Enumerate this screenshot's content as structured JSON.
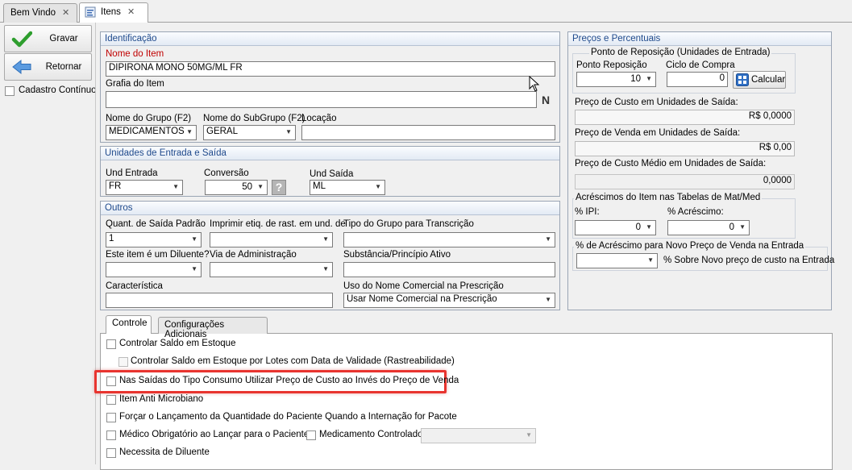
{
  "doc_tabs": [
    {
      "label": "Bem Vindo",
      "close": "✕"
    },
    {
      "label": "Itens",
      "close": "✕"
    }
  ],
  "toolbar": {
    "gravar": "Gravar",
    "retornar": "Retornar",
    "cadastro_continuo": "Cadastro Contínuo"
  },
  "identificacao": {
    "title": "Identificação",
    "nome_label": "Nome do Item",
    "nome_value": "DIPIRONA MONO 50MG/ML FR",
    "grafia_label": "Grafia do Item",
    "grafia_value": "",
    "n_glyph": "N",
    "grupo_label": "Nome do Grupo (F2)",
    "grupo_value": "MEDICAMENTOS",
    "subgrupo_label": "Nome do SubGrupo (F2)",
    "subgrupo_value": "GERAL",
    "locacao_label": "Locação",
    "locacao_value": ""
  },
  "unidades": {
    "title": "Unidades de Entrada e Saída",
    "und_entrada_label": "Und Entrada",
    "und_entrada_value": "FR",
    "conversao_label": "Conversão",
    "conversao_value": "50",
    "help_glyph": "?",
    "und_saida_label": "Und Saída",
    "und_saida_value": "ML"
  },
  "outros": {
    "title": "Outros",
    "quant_saida_label": "Quant. de Saída Padrão",
    "quant_saida_value": "1",
    "imprimir_label": "Imprimir etiq. de rast. em und. de",
    "imprimir_value": "",
    "tipo_grupo_label": "Tipo do Grupo para Transcrição",
    "tipo_grupo_value": "",
    "diluente_label": "Este item é um Diluente?",
    "diluente_value": "",
    "via_label": "Via de Administração",
    "via_value": "",
    "substancia_label": "Substância/Princípio Ativo",
    "substancia_value": "",
    "caracteristica_label": "Característica",
    "caracteristica_value": "",
    "uso_nome_label": "Uso do Nome Comercial na Prescrição",
    "uso_nome_value": "Usar Nome Comercial na Prescrição"
  },
  "precos": {
    "title": "Preços e Percentuais",
    "reposicao_legend": "Ponto de Reposição (Unidades de Entrada)",
    "ponto_label": "Ponto Reposição",
    "ponto_value": "10",
    "ciclo_label": "Ciclo de Compra",
    "ciclo_value": "0",
    "calcular": "Calcular",
    "custo_label": "Preço de Custo em Unidades de Saída:",
    "custo_value": "R$ 0,0000",
    "venda_label": "Preço de Venda em Unidades de Saída:",
    "venda_value": "R$ 0,00",
    "medio_label": "Preço de Custo Médio em Unidades de Saída:",
    "medio_value": "0,0000",
    "acrescimos_legend": "Acréscimos do Item nas Tabelas de Mat/Med",
    "ipi_label": "% IPI:",
    "ipi_value": "0",
    "acrescimo_label": "% Acréscimo:",
    "acrescimo_value": "0",
    "novo_legend": "% de Acréscimo para Novo Preço de Venda na Entrada",
    "novo_value": "",
    "novo_desc": "% Sobre Novo preço de custo na Entrada"
  },
  "bottom_tabs": [
    {
      "label": "Controle"
    },
    {
      "label": "Configurações Adicionais"
    }
  ],
  "controle": {
    "saldo_estoque": "Controlar Saldo em Estoque",
    "saldo_lotes": "Controlar Saldo em Estoque por Lotes com Data de Validade (Rastreabilidade)",
    "consumo_custo": "Nas Saídas do Tipo Consumo Utilizar Preço de Custo ao Invés do Preço de Venda",
    "anti_microbiano": "Item Anti Microbiano",
    "forcar_lancamento": "Forçar o Lançamento da Quantidade do Paciente Quando a Internação for Pacote",
    "medico_obrigatorio": "Médico Obrigatório ao Lançar para o Paciente",
    "medicamento_controlado": "Medicamento Controlado",
    "controlado_value": "",
    "necessita_diluente": "Necessita de Diluente"
  },
  "colors": {
    "group_title": "#1f4a8c",
    "required_label": "#c00000",
    "highlight": "#e8342f",
    "gravar_icon": "#2e9e2e",
    "retornar_icon": "#3a7fd0"
  },
  "icons": {
    "gravar": "check-icon",
    "retornar": "arrow-left-icon",
    "calcular": "calculator-icon",
    "itens_tab": "form-icon"
  }
}
